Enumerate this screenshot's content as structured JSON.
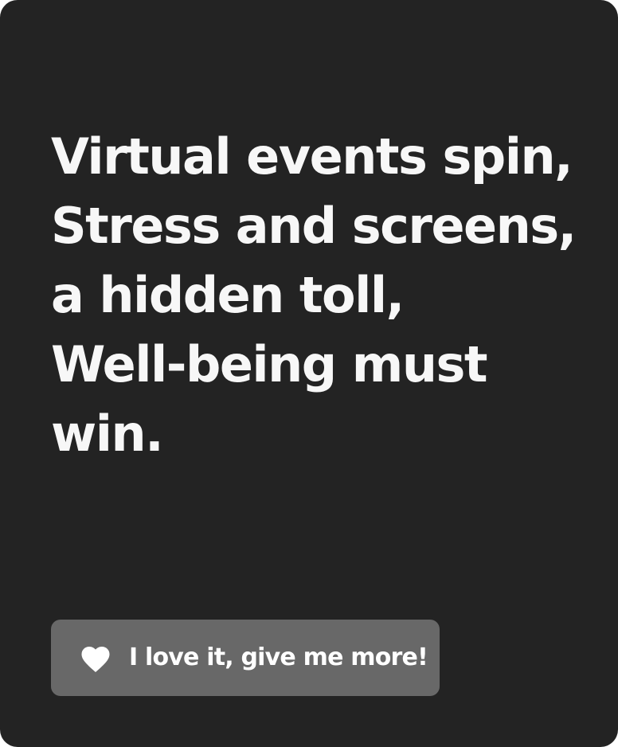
{
  "poem": {
    "lines": [
      "Virtual events spin,",
      "Stress and screens,",
      "a hidden toll,",
      "Well-being must",
      "win."
    ]
  },
  "action": {
    "label": "I love it, give me more!",
    "icon": "heart-icon"
  },
  "colors": {
    "card_background": "#232323",
    "button_background": "#686868",
    "text": "#ffffff"
  }
}
